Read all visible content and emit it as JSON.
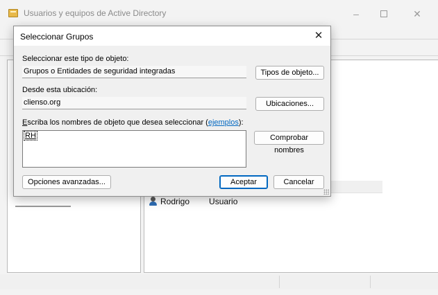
{
  "window": {
    "title": "Usuarios y equipos de Active Directory",
    "controls": {
      "minimize": "–",
      "close": "✕"
    }
  },
  "list": {
    "rows": [
      {
        "name": "Rodrigo",
        "type": "Usuario",
        "icon": "user-icon"
      }
    ]
  },
  "dialog": {
    "title": "Seleccionar Grupos",
    "close_glyph": "✕",
    "object_type_label": "Seleccionar este tipo de objeto:",
    "object_type_value": "Grupos o Entidades de seguridad integradas",
    "object_types_button": "Tipos de objeto...",
    "location_label": "Desde esta ubicación:",
    "location_value": "clienso.org",
    "locations_button": "Ubicaciones...",
    "names_label_mnemonic": "E",
    "names_label_rest": "scriba los nombres de objeto que desea seleccionar (",
    "names_label_link": "ejemplos",
    "names_label_end": "):",
    "names_value": "RH",
    "check_names_button": "Comprobar nombres",
    "advanced_button": "Opciones avanzadas...",
    "ok_button": "Aceptar",
    "cancel_button": "Cancelar"
  },
  "colors": {
    "accent": "#0067c0",
    "dialog_bg": "#f0f0f0",
    "window_bg": "#f3f3f3"
  }
}
